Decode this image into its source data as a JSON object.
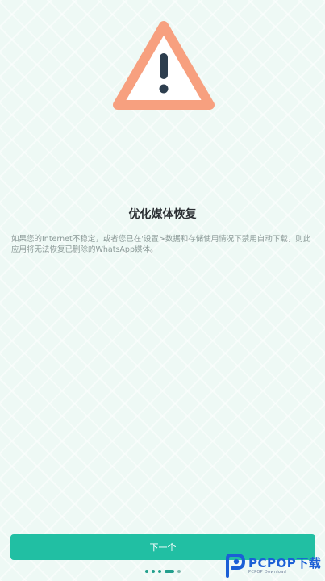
{
  "icons": {
    "warning": "warning-triangle-icon",
    "logo": "pcpop-logo-icon"
  },
  "colors": {
    "accent": "#21bfa3",
    "warning": "#f7a07f",
    "dot": "#239f8d"
  },
  "content": {
    "title": "优化媒体恢复",
    "description": "如果您的Internet不稳定，或者您已在'设置>数据和存储使用情况下禁用自动下载，则此应用将无法恢复已删除的WhatsApp媒体。"
  },
  "footer": {
    "next_label": "下一个"
  },
  "pager": {
    "total": 5,
    "current": 4
  },
  "watermark": {
    "brand": "PCPOP下载",
    "sub": "PCPOP Download"
  }
}
